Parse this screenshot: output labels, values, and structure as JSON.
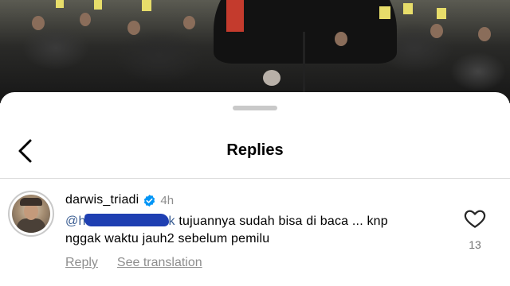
{
  "header": {
    "title": "Replies"
  },
  "comment": {
    "username": "darwis_triadi",
    "time": "4h",
    "mention_prefix": "@h",
    "mention_tail": "k",
    "text_line1": " tujuannya sudah bisa di baca ... knp",
    "text_line2": "nggak waktu jauh2 sebelum pemilu",
    "like_count": "13",
    "reply_label": "Reply",
    "translation_label": "See translation"
  },
  "icons": {
    "back": "chevron-left-icon",
    "verified": "verified-badge-icon",
    "like": "heart-outline-icon"
  },
  "colors": {
    "accent": "#0095f6",
    "muted": "#8e8e8e",
    "mention": "#3a5d92",
    "redaction": "#1e3fb2"
  }
}
